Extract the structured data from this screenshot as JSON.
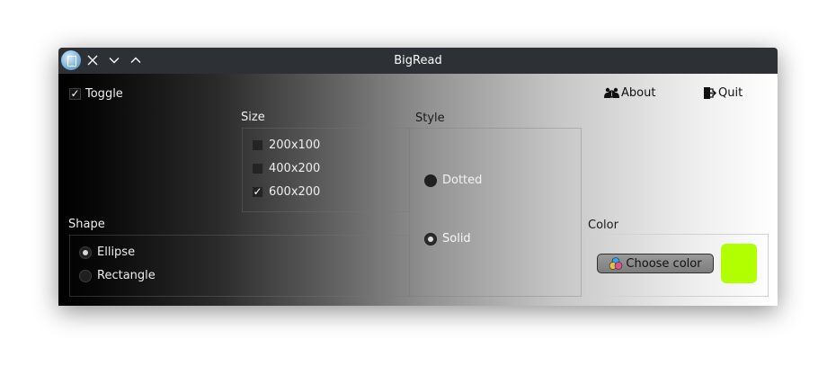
{
  "window": {
    "title": "BigRead",
    "buttons": [
      "close",
      "minimize",
      "maximize"
    ]
  },
  "toggle": {
    "label": "Toggle",
    "checked": true
  },
  "toolbar": {
    "about_label": "About",
    "quit_label": "Quit"
  },
  "size": {
    "title": "Size",
    "options": [
      {
        "label": "200x100",
        "checked": false
      },
      {
        "label": "400x200",
        "checked": false
      },
      {
        "label": "600x200",
        "checked": true
      }
    ]
  },
  "style": {
    "title": "Style",
    "options": [
      {
        "label": "Dotted",
        "selected": false
      },
      {
        "label": "Solid",
        "selected": true
      }
    ]
  },
  "shape": {
    "title": "Shape",
    "options": [
      {
        "label": "Ellipse",
        "selected": true
      },
      {
        "label": "Rectangle",
        "selected": false
      }
    ]
  },
  "color": {
    "title": "Color",
    "button_label": "Choose color",
    "current": "#b2ff00"
  },
  "colors": {
    "titlebar_bg": "#2d3136",
    "text_light": "#eeeeee",
    "text_dark": "#111111"
  },
  "icons": [
    "app-icon",
    "close-icon",
    "minimize-icon",
    "maximize-icon",
    "about-icon",
    "quit-icon",
    "color-palette-icon"
  ]
}
